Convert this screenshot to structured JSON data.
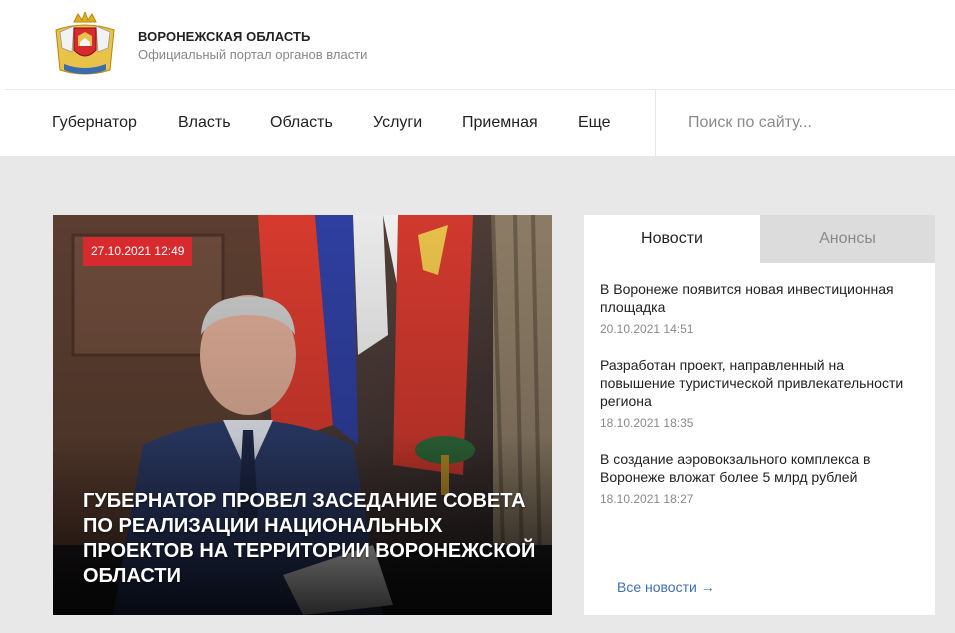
{
  "header": {
    "title": "ВОРОНЕЖСКАЯ ОБЛАСТЬ",
    "subtitle": "Официальный портал органов власти"
  },
  "nav": {
    "items": [
      {
        "label": "Губернатор"
      },
      {
        "label": "Власть"
      },
      {
        "label": "Область"
      },
      {
        "label": "Услуги"
      },
      {
        "label": "Приемная"
      },
      {
        "label": "Еще"
      }
    ],
    "search_placeholder": "Поиск по сайту..."
  },
  "hero": {
    "date": "27.10.2021 12:49",
    "title": "Губернатор провел заседание совета по реализации национальных проектов на территории Воронежской области"
  },
  "news_panel": {
    "tabs": [
      {
        "label": "Новости",
        "active": true
      },
      {
        "label": "Анонсы",
        "active": false
      }
    ],
    "items": [
      {
        "title": "В Воронеже появится новая инвестиционная площадка",
        "date": "20.10.2021 14:51"
      },
      {
        "title": "Разработан проект, направленный на повышение туристической привлекательности региона",
        "date": "18.10.2021 18:35"
      },
      {
        "title": "В создание аэровокзального комплекса в Воронеже вложат более 5 млрд рублей",
        "date": "18.10.2021 18:27"
      }
    ],
    "all_news_label": "Все новости →"
  },
  "colors": {
    "accent_red": "#d62a2e",
    "link_blue": "#3e6fb6",
    "background": "#e8e8e8"
  }
}
